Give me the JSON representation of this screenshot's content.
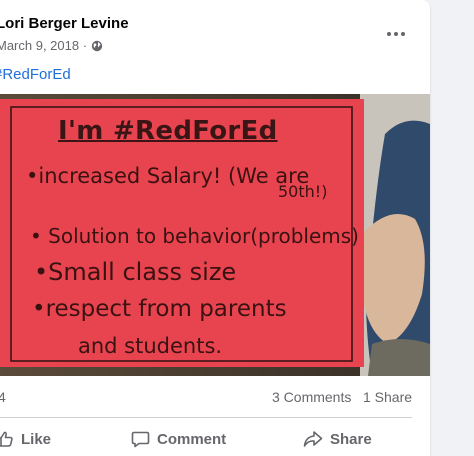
{
  "post": {
    "author": "Lori Berger Levine",
    "date": "March 9, 2018 ·",
    "hashtag": "#RedForEd",
    "more_icon": "more-horizontal-icon",
    "privacy_icon": "globe-icon"
  },
  "photo": {
    "sign_title": "I'm #RedForEd",
    "sign_lines": [
      "•increased Salary! (We are",
      "50th!)",
      "• Solution to behavior(problems)",
      "•Small class size",
      "•respect from parents",
      "and students."
    ],
    "sign_color": "#e8444f"
  },
  "stats": {
    "reactions": "4",
    "comments": "3 Comments",
    "shares": "1 Share"
  },
  "actions": {
    "like": "Like",
    "comment": "Comment",
    "share": "Share"
  }
}
